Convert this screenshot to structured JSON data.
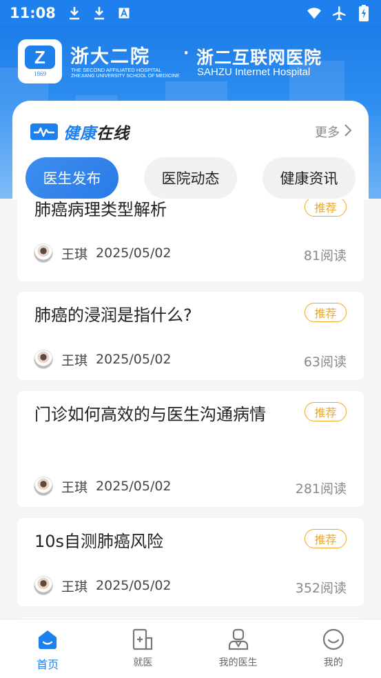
{
  "status_bar": {
    "time": "11:08",
    "left_icons": [
      "download-icon",
      "download-icon",
      "font-icon"
    ],
    "right_icons": [
      "wifi-icon",
      "airplane-icon",
      "battery-charging-icon"
    ]
  },
  "header": {
    "hospital_name_cn": "浙大二院",
    "hospital_name_en_1": "THE SECOND AFFILIATED HOSPITAL",
    "hospital_name_en_2": "ZHEJIANG UNIVERSITY SCHOOL OF MEDICINE",
    "logo_letter": "Z",
    "logo_year": "1869",
    "separator": "·",
    "internet_hospital_cn": "浙二互联网医院",
    "internet_hospital_en": "SAHZU Internet Hospital"
  },
  "section": {
    "title_blue": "健康",
    "title_dark": "在线",
    "more_label": "更多",
    "tabs": [
      {
        "label": "医生发布",
        "active": true
      },
      {
        "label": "医院动态",
        "active": false
      },
      {
        "label": "健康资讯",
        "active": false
      }
    ]
  },
  "articles": [
    {
      "title": "肺癌病理类型解析",
      "badge": "推荐",
      "author": "王琪",
      "date": "2025/05/02",
      "reads": "81阅读"
    },
    {
      "title": "肺癌的浸润是指什么?",
      "badge": "推荐",
      "author": "王琪",
      "date": "2025/05/02",
      "reads": "63阅读"
    },
    {
      "title": "门诊如何高效的与医生沟通病情",
      "badge": "推荐",
      "author": "王琪",
      "date": "2025/05/02",
      "reads": "281阅读"
    },
    {
      "title": "10s自测肺癌风险",
      "badge": "推荐",
      "author": "王琪",
      "date": "2025/05/02",
      "reads": "352阅读"
    }
  ],
  "bottom_nav": [
    {
      "label": "首页",
      "icon": "home-icon",
      "active": true
    },
    {
      "label": "就医",
      "icon": "medical-clipboard-icon",
      "active": false
    },
    {
      "label": "我的医生",
      "icon": "doctor-icon",
      "active": false
    },
    {
      "label": "我的",
      "icon": "smile-face-icon",
      "active": false
    }
  ],
  "colors": {
    "accent": "#1e80ec",
    "badge": "#f2a623"
  }
}
